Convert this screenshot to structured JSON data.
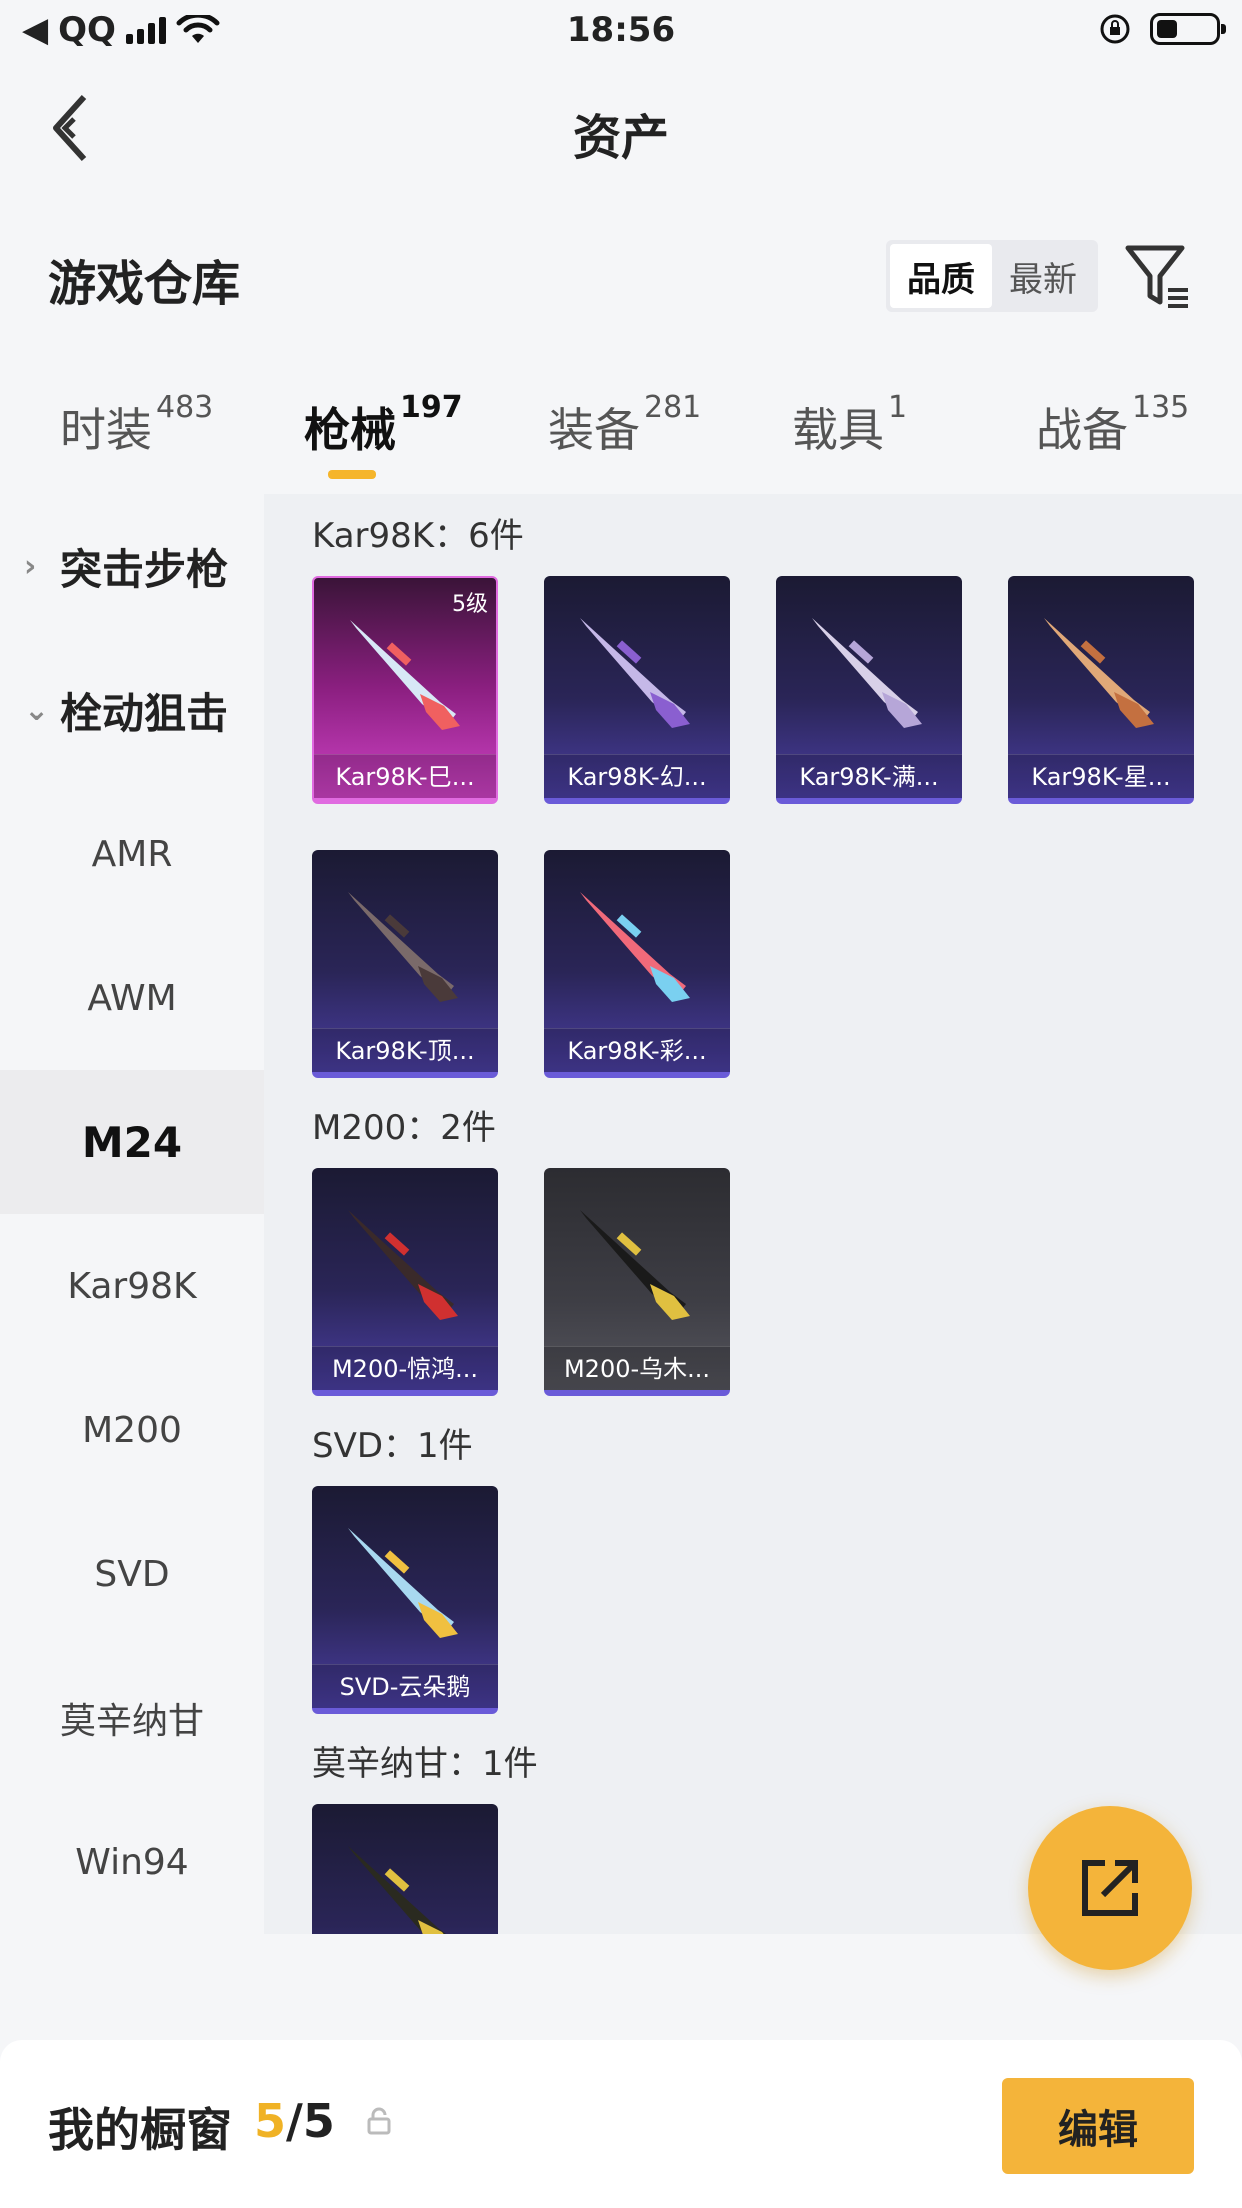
{
  "status_bar": {
    "carrier": "QQ",
    "time": "18:56"
  },
  "header": {
    "title": "资产"
  },
  "warehouse": {
    "title": "游戏仓库",
    "sort_options": [
      "品质",
      "最新"
    ],
    "active_sort": "品质"
  },
  "tabs": [
    {
      "label": "时装",
      "count": "483"
    },
    {
      "label": "枪械",
      "count": "197"
    },
    {
      "label": "装备",
      "count": "281"
    },
    {
      "label": "载具",
      "count": "1"
    },
    {
      "label": "战备",
      "count": "135"
    }
  ],
  "category_nav": {
    "groups": [
      "突击步枪",
      "栓动狙击"
    ],
    "items": [
      "AMR",
      "AWM",
      "M24",
      "Kar98K",
      "M200",
      "SVD",
      "莫辛纳甘",
      "Win94"
    ],
    "active_item": "M24"
  },
  "content": {
    "groups": [
      {
        "label": "Kar98K：6件"
      },
      {
        "label": "M200：2件"
      },
      {
        "label": "SVD：1件"
      },
      {
        "label": "莫辛纳甘：1件"
      }
    ],
    "cards": [
      {
        "name": "Kar98K-巳...",
        "level": "5级",
        "style": "pink",
        "gun_color": "#d8e8f6",
        "accent": "#f06060"
      },
      {
        "name": "Kar98K-幻...",
        "style": "purple",
        "gun_color": "#c5b8e8",
        "accent": "#8a5fd0"
      },
      {
        "name": "Kar98K-满...",
        "style": "purple",
        "gun_color": "#d8d0e8",
        "accent": "#b6a6d8"
      },
      {
        "name": "Kar98K-星...",
        "style": "purple",
        "gun_color": "#e0a878",
        "accent": "#c47040"
      },
      {
        "name": "Kar98K-顶...",
        "style": "purple",
        "gun_color": "#7a6a6a",
        "accent": "#4a3a3a"
      },
      {
        "name": "Kar98K-彩...",
        "style": "purple",
        "gun_color": "#f06a7a",
        "accent": "#7ad0f0"
      },
      {
        "name": "M200-惊鸿...",
        "style": "purple",
        "gun_color": "#3a2a2a",
        "accent": "#d03030"
      },
      {
        "name": "M200-乌木...",
        "style": "grey",
        "gun_color": "#1a1a1a",
        "accent": "#e0c040"
      },
      {
        "name": "SVD-云朵鹅",
        "style": "purple",
        "gun_color": "#a8d8f0",
        "accent": "#f0c040"
      },
      {
        "name": "",
        "style": "purple",
        "gun_color": "#2a2a20",
        "accent": "#e0c040"
      }
    ]
  },
  "showcase": {
    "title": "我的橱窗",
    "current": "5",
    "total": "/5",
    "edit_label": "编辑"
  },
  "colors": {
    "accent": "#f4b43a",
    "tab_underline": "#f5b52b"
  }
}
